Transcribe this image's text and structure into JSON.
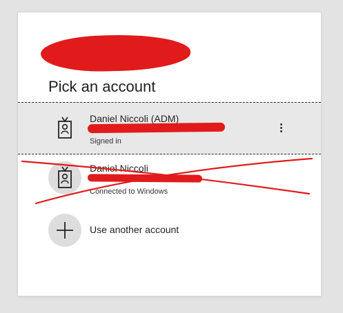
{
  "title": "Pick an account",
  "accounts": [
    {
      "name": "Daniel Niccoli (ADM)",
      "status": "Signed in",
      "icon": "badge-icon"
    },
    {
      "name": "Daniel Niccoli",
      "status": "Connected to Windows",
      "icon": "badge-icon"
    }
  ],
  "add_account": {
    "label": "Use another account",
    "icon": "plus-icon"
  },
  "colors": {
    "redaction": "#e11b1b",
    "selected_background": "#e8e8e8"
  }
}
